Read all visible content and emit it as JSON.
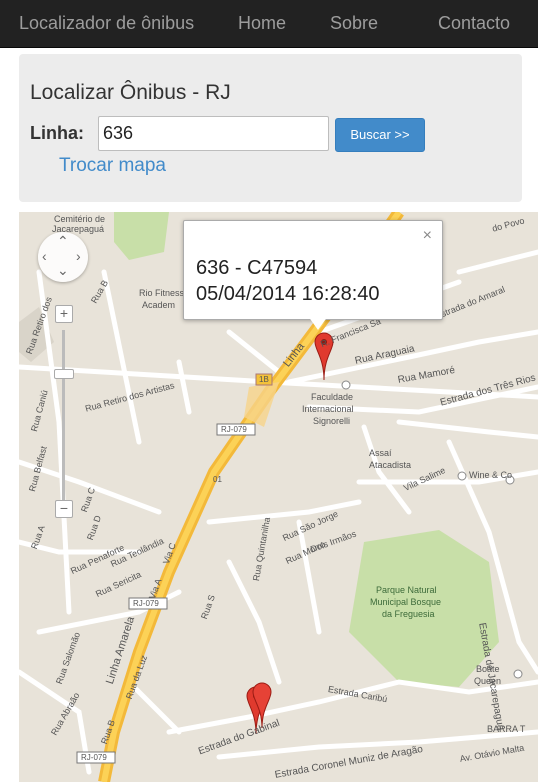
{
  "navbar": {
    "brand": "Localizador de ônibus",
    "links": [
      "Home",
      "Sobre",
      "Contacto"
    ]
  },
  "form": {
    "title": "Localizar Ônibus - RJ",
    "linha_label": "Linha:",
    "linha_value": "636",
    "search_button": "Buscar >>",
    "change_map_link": "Trocar mapa"
  },
  "map": {
    "info_window": {
      "line1": "636 - C47594",
      "line2": "05/04/2014 16:28:40",
      "close": "×"
    },
    "zoom": {
      "in": "+",
      "out": "−"
    },
    "labels": {
      "cemiterio1": "Cemitério de",
      "cemiterio2": "Jacarepaguá",
      "rio_fitness": "Rio Fitness",
      "academ": "Academ",
      "francisca": "R. Francisca Sa",
      "amaral": "Estrada do Amaral",
      "araguaia": "Rua Araguaia",
      "mamore": "Rua Mamoré",
      "tres_rios": "Estrada dos Três Rios",
      "faculdade1": "Faculdade",
      "faculdade2": "Internacional",
      "faculdade3": "Signorelli",
      "assai1": "Assaí",
      "assai2": "Atacadista",
      "wine": "Wine & Co",
      "vila_salime": "Vila Salime",
      "retiro": "Rua Retiro dos Artistas",
      "retiro_vert": "Rua Retiro dos",
      "caniu": "Rua Caniú",
      "belfast": "Rua Belfast",
      "penaforte": "Rua Penaforte",
      "teolandia": "Rua Teolândia",
      "sericita": "Rua Sericita",
      "via_c": "Via C",
      "via_a": "Via A",
      "rua_a": "Rua A",
      "rua_b": "Rua B",
      "rua_c": "Rua C",
      "rua_d": "Rua D",
      "sao_jorge": "Rua São Jorge",
      "quintanilha": "Rua Quintanilha",
      "morro": "Rua Morro",
      "irmaos": "Dois Irmãos",
      "rj079a": "RJ-079",
      "rj079b": "RJ-079",
      "rj079c": "RJ-079",
      "r01": "01",
      "r1b": "1B",
      "linha_amarela": "Linha Amarela",
      "linha_top": "Linha",
      "parque1": "Parque Natural",
      "parque2": "Municipal Bosque",
      "parque3": "da Freguesia",
      "estrada_jacarepagua": "Estrada de Jacarepaguá",
      "boate1": "Boate",
      "boate2": "Queen",
      "barra": "BARRA T",
      "otavio": "Av. Otávio Malta",
      "gabinal": "Estrada do Gabinal",
      "caribu": "Estrada Caribú",
      "coronel": "Estrada Coronel Muniz de Aragão",
      "salomao": "Rua Salomão",
      "abrao": "Rua Abraão",
      "luz": "Rua da Luz",
      "rua_s": "Rua S",
      "povo": "do Povo",
      "rua_b2": "Rua B"
    }
  }
}
